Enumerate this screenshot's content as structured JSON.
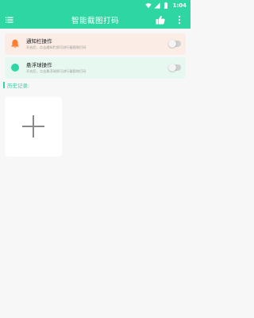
{
  "status_bar": {
    "time": "1:04"
  },
  "app_bar": {
    "title": "智能截图打码"
  },
  "cards": {
    "notify": {
      "title": "通知栏操作",
      "description": "开启后，点击通知栏即可进行截图和打码",
      "enabled": false
    },
    "float": {
      "title": "悬浮球操作",
      "description": "开启后，点击悬浮球即可进行截图和打码",
      "enabled": false
    }
  },
  "history": {
    "label": "历史记录:"
  },
  "colors": {
    "accent": "#2ed6a3",
    "notify_bg": "#fbece5",
    "float_bg": "#e7f8f1",
    "bell": "#ff7f2f",
    "page_bg": "#f7f7f7"
  },
  "icons": {
    "status": [
      "wifi-icon",
      "signal-icon",
      "battery-icon"
    ],
    "app_bar": [
      "menu-icon",
      "thumbs-up-icon",
      "more-vertical-icon"
    ],
    "cards": [
      "bell-icon",
      "floating-ball-icon"
    ],
    "history": [
      "plus-icon"
    ]
  }
}
